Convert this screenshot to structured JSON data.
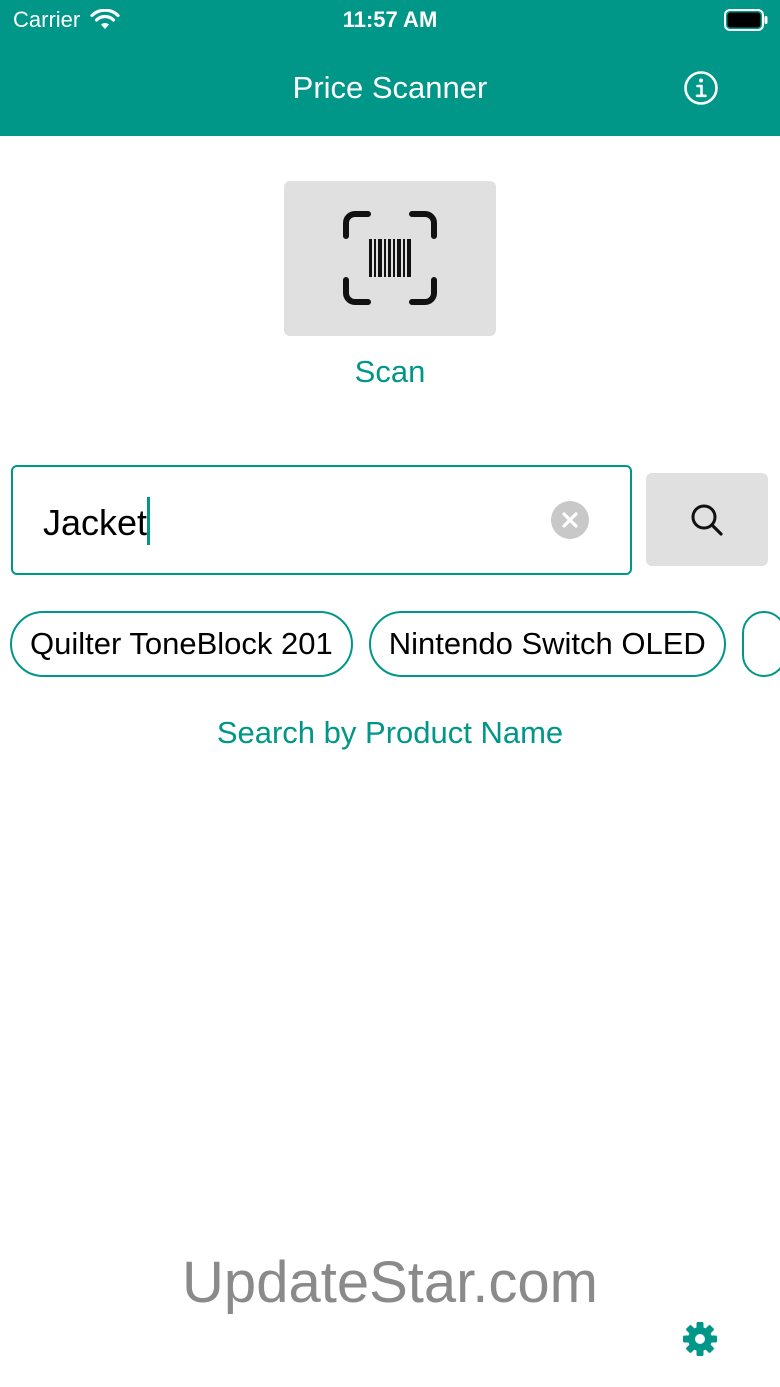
{
  "status_bar": {
    "carrier": "Carrier",
    "time": "11:57 AM"
  },
  "nav": {
    "title": "Price Scanner",
    "info_icon": "info-circle-icon"
  },
  "scan": {
    "icon": "barcode-scan-icon",
    "label": "Scan"
  },
  "search": {
    "value": "Jacket",
    "clear_icon": "clear-circle-icon",
    "button_icon": "magnifier-icon"
  },
  "suggestions": [
    {
      "label": "Quilter ToneBlock 201"
    },
    {
      "label": "Nintendo Switch OLED"
    }
  ],
  "hint": "Search by Product Name",
  "watermark": "UpdateStar.com",
  "settings_icon": "gear-icon",
  "colors": {
    "accent": "#009688",
    "button_bg": "#e0e0e0",
    "watermark": "#8a8a8a"
  }
}
